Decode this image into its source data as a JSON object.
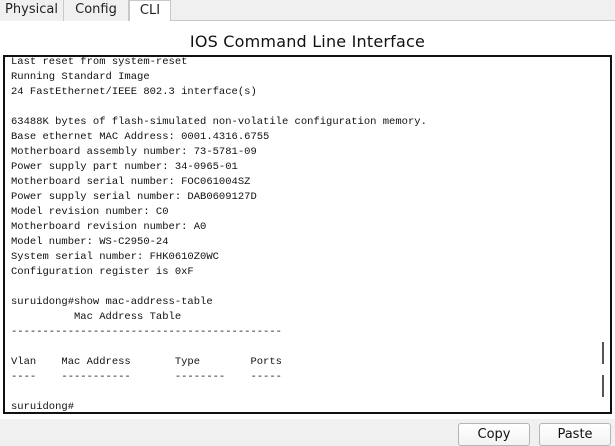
{
  "tabs": [
    {
      "label": "Physical",
      "active": false
    },
    {
      "label": "Config",
      "active": false
    },
    {
      "label": "CLI",
      "active": true
    }
  ],
  "title": "IOS Command Line Interface",
  "console": {
    "text": "Last reset from system-reset\nRunning Standard Image\n24 FastEthernet/IEEE 802.3 interface(s)\n\n63488K bytes of flash-simulated non-volatile configuration memory.\nBase ethernet MAC Address: 0001.4316.6755\nMotherboard assembly number: 73-5781-09\nPower supply part number: 34-0965-01\nMotherboard serial number: FOC061004SZ\nPower supply serial number: DAB0609127D\nModel revision number: C0\nMotherboard revision number: A0\nModel number: WS-C2950-24\nSystem serial number: FHK0610Z0WC\nConfiguration register is 0xF\n\nsuruidong#show mac-address-table\n          Mac Address Table\n-------------------------------------------\n\nVlan    Mac Address       Type        Ports\n----    -----------       --------    -----\n\nsuruidong#"
  },
  "buttons": {
    "copy": "Copy",
    "paste": "Paste"
  }
}
